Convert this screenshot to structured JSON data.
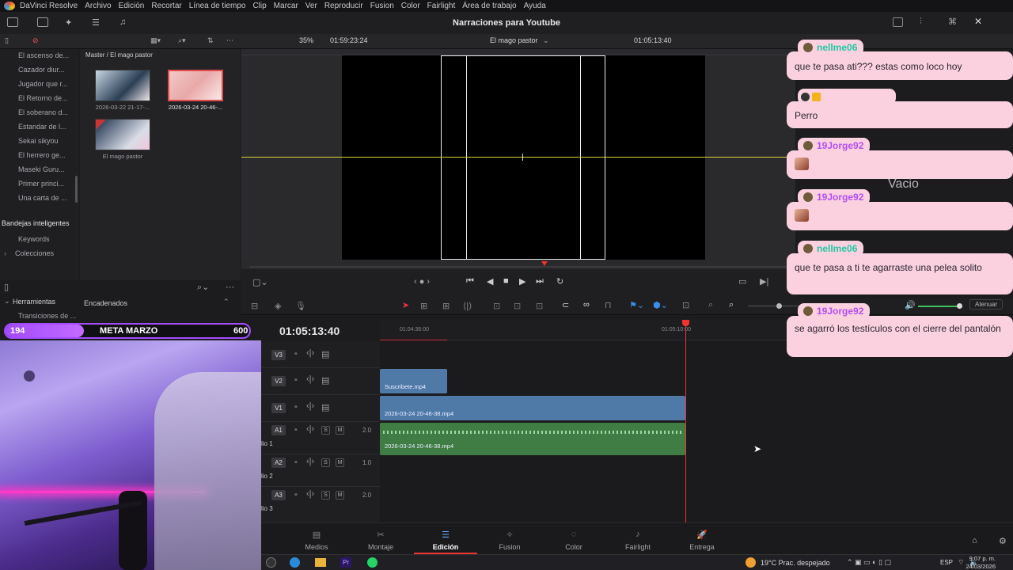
{
  "app": {
    "name": "DaVinci Resolve",
    "menu": [
      "Archivo",
      "Edición",
      "Recortar",
      "Línea de tiempo",
      "Clip",
      "Marcar",
      "Ver",
      "Reproducir",
      "Fusion",
      "Color",
      "Fairlight",
      "Área de trabajo",
      "Ayuda"
    ],
    "project_title": "Narraciones para Youtube"
  },
  "viewer": {
    "zoom": "35%",
    "source_timecode": "01:59:23:24",
    "timeline_name": "El mago pastor",
    "record_timecode": "01:05:13:40"
  },
  "bins": {
    "items": [
      "El ascenso de...",
      "Cazador diur...",
      "Jugador que r...",
      "El Retorno de...",
      "El soberano d...",
      "Estandar de l...",
      "Sekai sikyou",
      "El herrero ge...",
      "Maseki Guru...",
      "Primer princi...",
      "Una carta de ..."
    ],
    "smart_title": "Bandejas inteligentes",
    "smart_items": [
      "Keywords",
      "Colecciones"
    ]
  },
  "media_pool": {
    "breadcrumb": "Master / El mago pastor",
    "clips": [
      "2026-03-22 21-17-...",
      "2026-03-24 20-46-...",
      "El mago pastor"
    ]
  },
  "effects": {
    "tools_label": "Herramientas",
    "transitions_label": "Transiciones de ...",
    "chained_label": "Encadenados"
  },
  "timeline": {
    "big_timecode": "01:05:13:40",
    "ruler": [
      "01:04:36:00",
      "01:05:10:00"
    ],
    "tracks": [
      {
        "name": "V3"
      },
      {
        "name": "V2"
      },
      {
        "name": "V1"
      },
      {
        "name": "A1",
        "level": "2.0",
        "label": "lio 1"
      },
      {
        "name": "A2",
        "level": "1.0",
        "label": "lio 2"
      },
      {
        "name": "A3",
        "level": "2.0",
        "label": "lio 3"
      }
    ],
    "clip_v2": "Suscribete.mp4",
    "clip_v1": "2026-03-24 20-46-38.mp4",
    "clip_a1": "2026-03-24 20-46-38.mp4",
    "atenuar": "Atenuar"
  },
  "pages": [
    "Medios",
    "Montaje",
    "Edición",
    "Fusion",
    "Color",
    "Fairlight",
    "Entrega"
  ],
  "active_page": "Edición",
  "goal": {
    "current": "194",
    "label": "META MARZO",
    "target": "600",
    "progress": 0.323
  },
  "chat": [
    {
      "user": "nellme06",
      "color": "#1fc9a2",
      "text": "que te pasa ati??? estas como loco hoy"
    },
    {
      "user": "",
      "color": "#f2b21c",
      "text": "Perro"
    },
    {
      "user": "19Jorge92",
      "color": "#b44df0",
      "text": ""
    },
    {
      "user": "19Jorge92",
      "color": "#b44df0",
      "text": ""
    },
    {
      "user": "nellme06",
      "color": "#1fc9a2",
      "text": "que te pasa a ti te agarraste una pelea solito"
    },
    {
      "user": "19Jorge92",
      "color": "#b44df0",
      "text": "se agarró los testículos con el cierre del pantalón"
    }
  ],
  "overlay_text": "Vacio",
  "taskbar": {
    "weather": "19°C  Prac. despejado",
    "lang": "ESP",
    "time": "9:07 p. m.",
    "date": "24/03/2026"
  }
}
